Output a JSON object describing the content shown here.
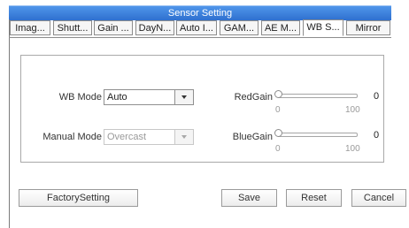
{
  "window": {
    "title": "Sensor Setting"
  },
  "tabs": [
    {
      "label": "Imag..."
    },
    {
      "label": "Shutt..."
    },
    {
      "label": "Gain ..."
    },
    {
      "label": "DayN..."
    },
    {
      "label": "Auto I..."
    },
    {
      "label": "GAM..."
    },
    {
      "label": "AE M..."
    },
    {
      "label": "WB S..."
    },
    {
      "label": "Mirror"
    }
  ],
  "active_tab": "WB S...",
  "wb_mode": {
    "label": "WB Mode",
    "value": "Auto"
  },
  "manual_mode": {
    "label": "Manual Mode",
    "value": "Overcast",
    "enabled": false
  },
  "red_gain": {
    "label": "RedGain",
    "value": "0",
    "min": "0",
    "max": "100"
  },
  "blue_gain": {
    "label": "BlueGain",
    "value": "0",
    "min": "0",
    "max": "100"
  },
  "buttons": {
    "factory": "FactorySetting",
    "save": "Save",
    "reset": "Reset",
    "cancel": "Cancel"
  }
}
